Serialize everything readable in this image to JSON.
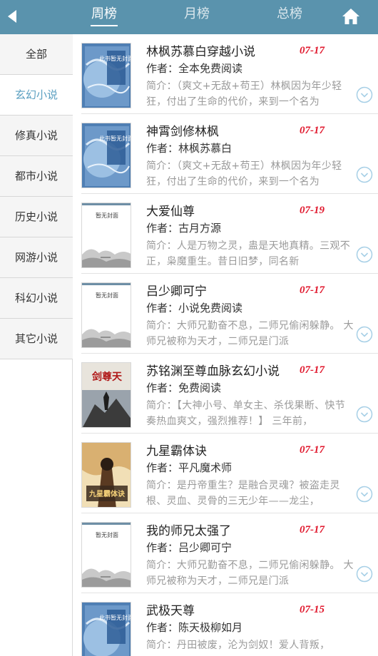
{
  "header": {
    "tabs": [
      {
        "label": "周榜",
        "active": true
      },
      {
        "label": "月榜",
        "active": false
      },
      {
        "label": "总榜",
        "active": false
      }
    ],
    "back_icon": "back-arrow-icon",
    "home_icon": "home-icon"
  },
  "sidebar": {
    "items": [
      {
        "label": "全部"
      },
      {
        "label": "玄幻小说",
        "active": true
      },
      {
        "label": "修真小说"
      },
      {
        "label": "都市小说"
      },
      {
        "label": "历史小说"
      },
      {
        "label": "网游小说"
      },
      {
        "label": "科幻小说"
      },
      {
        "label": "其它小说"
      }
    ]
  },
  "colors": {
    "header_bg": "#5a93ad",
    "active_category": "#5a9fc0",
    "date": "#e0162b",
    "intro_text": "#9a9a9a"
  },
  "books": [
    {
      "title": "林枫苏慕白穿越小说",
      "date": "07-17",
      "author": "作者：全本免费阅读",
      "intro": "简介：（爽文+无敌+苟王）林枫因为年少轻狂，付出了生命的代价，来到一个名为",
      "cover": "blue",
      "cover_text": "此书暂无封面"
    },
    {
      "title": "神霄剑修林枫",
      "date": "07-17",
      "author": "作者：林枫苏慕白",
      "intro": "简介：（爽文+无敌+苟王）林枫因为年少轻狂，付出了生命的代价，来到一个名为",
      "cover": "blue",
      "cover_text": "此书暂无封面"
    },
    {
      "title": "大爱仙尊",
      "date": "07-19",
      "author": "作者：古月方源",
      "intro": "简介：人是万物之灵，蛊是天地真精。三观不正，枭魔重生。昔日旧梦，同名新",
      "cover": "white",
      "cover_text": "暂无封面"
    },
    {
      "title": "吕少卿可宁",
      "date": "07-17",
      "author": "作者：小说免费阅读",
      "intro": "简介：大师兄勤奋不息，二师兄偷闲躲静。  大师兄被称为天才，二师兄是门派",
      "cover": "white",
      "cover_text": "暂无封面"
    },
    {
      "title": "苏铭渊至尊血脉玄幻小说",
      "date": "07-17",
      "author": "作者：免费阅读",
      "intro": "简介：【大神小号、单女主、杀伐果断、快节奏热血爽文，强烈推荐！】 三年前，",
      "cover": "art1",
      "cover_text": "剑尊天"
    },
    {
      "title": "九星霸体诀",
      "date": "07-17",
      "author": "作者：平凡魔术师",
      "intro": "简介：是丹帝重生？是融合灵魂？被盗走灵根、灵血、灵骨的三无少年——龙尘，",
      "cover": "art2",
      "cover_text": "九星霸体诀"
    },
    {
      "title": "我的师兄太强了",
      "date": "07-17",
      "author": "作者：吕少卿可宁",
      "intro": "简介：大师兄勤奋不息，二师兄偷闲躲静。  大师兄被称为天才，二师兄是门派",
      "cover": "white",
      "cover_text": "暂无封面"
    },
    {
      "title": "武极天尊",
      "date": "07-15",
      "author": "作者：陈天极柳如月",
      "intro": "简介：丹田被废，沦为剑奴！爱人背叛，",
      "cover": "blue",
      "cover_text": "此书暂无封面"
    }
  ]
}
